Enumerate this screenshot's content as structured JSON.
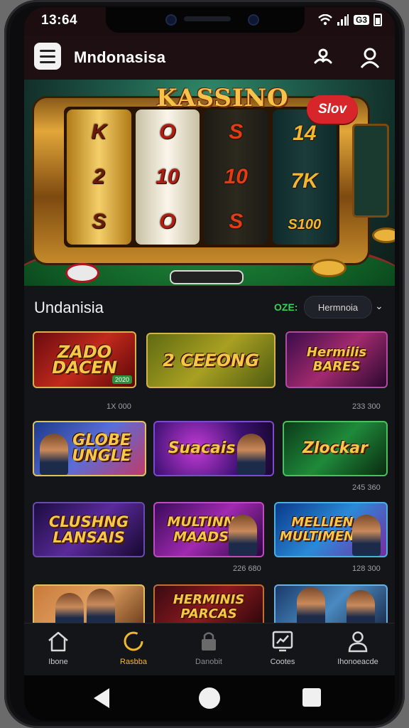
{
  "status": {
    "time": "13:64",
    "battery_text": "G3"
  },
  "header": {
    "title": "Mndonasisa"
  },
  "hero": {
    "title": "KASSINO",
    "badge": "Slov",
    "reels": [
      [
        "K",
        "2",
        "S"
      ],
      [
        "O",
        "10",
        "O"
      ],
      [
        "S",
        "10",
        "S"
      ],
      [
        "14",
        "7K",
        "S100"
      ]
    ]
  },
  "section": {
    "title": "Undanisia",
    "tag": "OZE:",
    "select_value": "Hermnoia"
  },
  "games": [
    {
      "label": "ZADO DACEN",
      "number": "1X 000",
      "badge": "2020"
    },
    {
      "label": "2 CEEONG",
      "number": ""
    },
    {
      "label": "Hermilis BARES",
      "number": "233 300"
    },
    {
      "label": "GLOBE UNGLE",
      "number": ""
    },
    {
      "label": "Suacais",
      "number": ""
    },
    {
      "label": "Zlockar",
      "number": "245 360"
    },
    {
      "label": "CLUSHNG LANSAIS",
      "number": ""
    },
    {
      "label": "MULTINN MAADS",
      "number": "226 680"
    },
    {
      "label": "MELLIEN MULTIMENN",
      "number": "128 300"
    },
    {
      "label": "",
      "number": ""
    },
    {
      "label": "HERMINIS PARCAS",
      "number": ""
    },
    {
      "label": "",
      "number": ""
    }
  ],
  "nav": [
    {
      "label": "Ibone",
      "icon": "home-icon"
    },
    {
      "label": "Rasbba",
      "icon": "refresh-icon"
    },
    {
      "label": "Danobit",
      "icon": "lock-icon"
    },
    {
      "label": "Cootes",
      "icon": "chart-icon"
    },
    {
      "label": "Ihonoeacde",
      "icon": "profile-icon"
    }
  ],
  "colors": {
    "accent": "#f0b82d",
    "badge_red": "#d6262c",
    "app_bg": "#131519",
    "tag_green": "#36d15a"
  }
}
